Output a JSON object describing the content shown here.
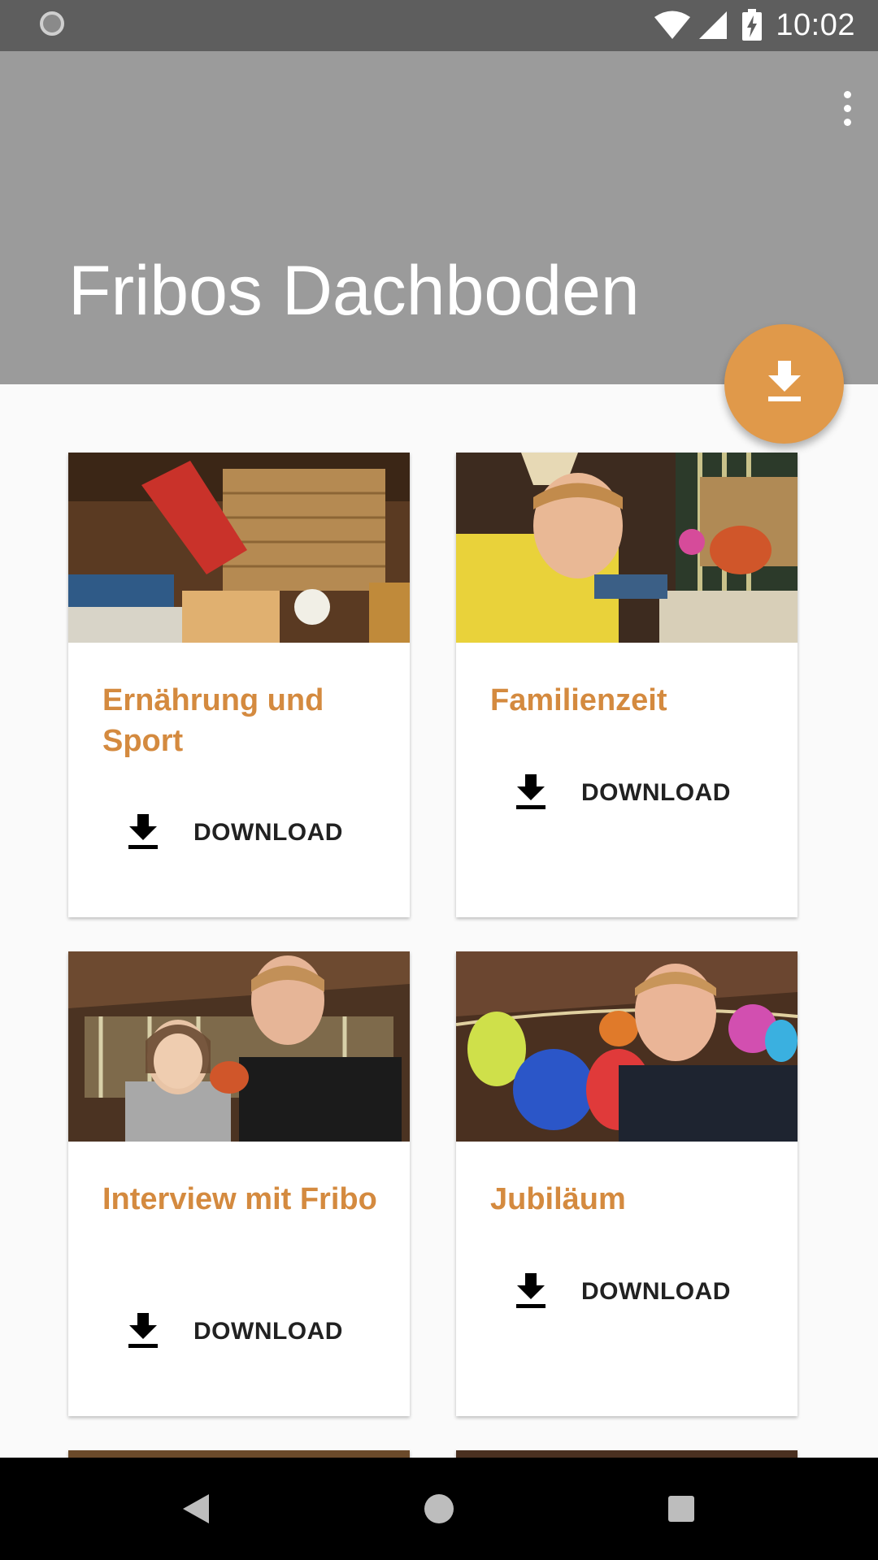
{
  "status_bar": {
    "time": "10:02",
    "icons": [
      "loading-icon",
      "wifi-icon",
      "signal-icon",
      "battery-charging-icon"
    ]
  },
  "app_bar": {
    "title": "Fribos Dachboden",
    "menu_icon": "more-vert-icon",
    "background": "#9b9b9b"
  },
  "fab": {
    "icon": "download-icon",
    "color": "#e0994a"
  },
  "episodes": [
    {
      "title": "Ernährung und Sport",
      "download_label": "DOWNLOAD",
      "thumb": "attic-basket-scene"
    },
    {
      "title": "Familienzeit",
      "download_label": "DOWNLOAD",
      "thumb": "man-with-puppet"
    },
    {
      "title": "Interview mit Fribo",
      "download_label": "DOWNLOAD",
      "thumb": "girl-and-man-with-puppet"
    },
    {
      "title": "Jubiläum",
      "download_label": "DOWNLOAD",
      "thumb": "anniversary-balloons"
    }
  ],
  "accent_color": "#d48a3f",
  "nav_bar": {
    "buttons": [
      "back-icon",
      "home-icon",
      "recents-icon"
    ]
  }
}
